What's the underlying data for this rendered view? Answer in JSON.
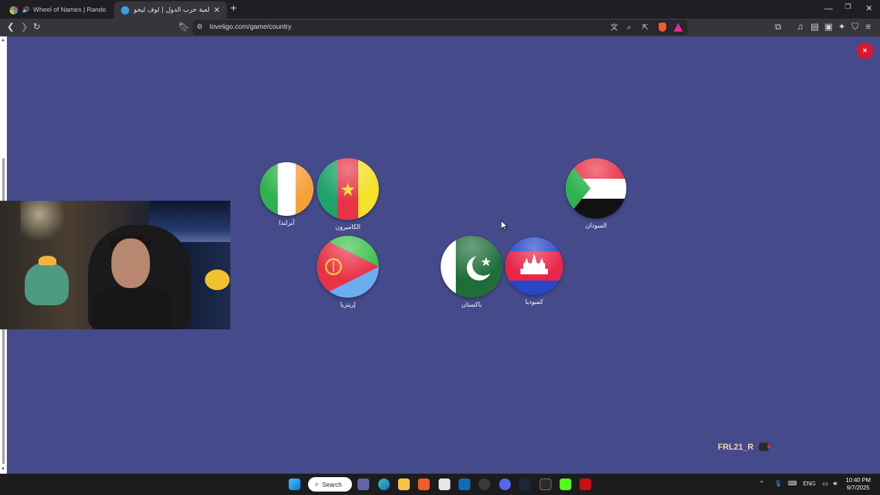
{
  "browser": {
    "tabs": [
      {
        "title": "Wheel of Names | Random name",
        "active": false
      },
      {
        "title": "لعبة حرب الدول | لوف ليجو يوفر أفـ",
        "active": true
      }
    ],
    "new_tab_icon": "plus-icon",
    "address": "loveligo.com/game/country"
  },
  "page": {
    "background_color": "#444a8a",
    "close_icon": "×",
    "flags": [
      {
        "country": "أيرلندا",
        "flag": "ireland"
      },
      {
        "country": "الكاميرون",
        "flag": "cameroon"
      },
      {
        "country": "السودان",
        "flag": "sudan"
      },
      {
        "country": "إريتريا",
        "flag": "eritrea"
      },
      {
        "country": "باكستان",
        "flag": "pakistan"
      },
      {
        "country": "كمبوديا",
        "flag": "cambodia"
      }
    ],
    "username": "FRL21_R"
  },
  "taskbar": {
    "search_label": "Search",
    "language": "ENG",
    "time": "10:40 PM",
    "date": "9/7/2025"
  }
}
